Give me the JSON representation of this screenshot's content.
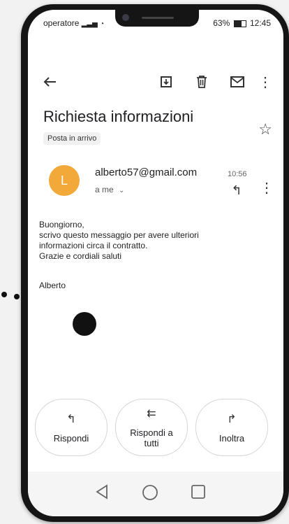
{
  "status_bar": {
    "carrier": "operatore",
    "battery": "63%",
    "time": "12:45"
  },
  "toolbar": {
    "back_icon": "arrow-left-icon",
    "archive_icon": "archive-icon",
    "delete_icon": "trash-icon",
    "mark_unread_icon": "envelope-icon",
    "more_icon": "more-vert-icon"
  },
  "email": {
    "subject": "Richiesta informazioni",
    "label": "Posta in arrivo",
    "sender_initial": "L",
    "sender": "alberto57@gmail.com",
    "time": "10:56",
    "recipient": "a me",
    "body": [
      "Buongiorno,",
      "scrivo questo messaggio per avere ulteriori",
      "informazioni circa il contratto.",
      "Grazie e cordiali saluti"
    ],
    "signature": "Alberto"
  },
  "actions": {
    "reply": "Rispondi",
    "reply_all": "Rispondi a tutti",
    "forward": "Inoltra"
  },
  "colors": {
    "avatar": "#f3a83a",
    "phone_frame": "#151515"
  }
}
